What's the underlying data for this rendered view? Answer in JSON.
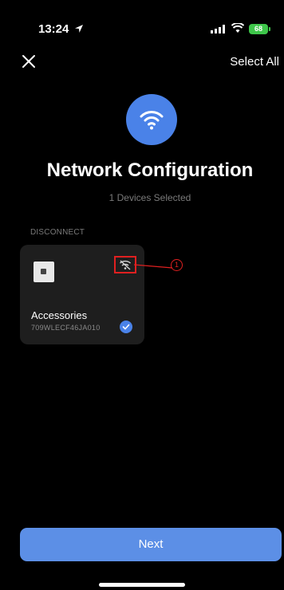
{
  "status_bar": {
    "time": "13:24",
    "battery": "68"
  },
  "nav": {
    "select_all_label": "Select All"
  },
  "header": {
    "title": "Network Configuration",
    "subtitle": "1 Devices Selected"
  },
  "section": {
    "label": "DISCONNECT"
  },
  "devices": [
    {
      "name": "Accessories",
      "serial": "709WLECF46JA010",
      "selected": true,
      "status_icon": "wifi-off-icon"
    }
  ],
  "annotation": {
    "number": "1"
  },
  "footer": {
    "next_label": "Next"
  },
  "colors": {
    "accent": "#4a82e8",
    "button": "#5c8fe6",
    "card": "#1e1e1e",
    "annotation": "#e02020",
    "battery": "#3ec64a"
  }
}
